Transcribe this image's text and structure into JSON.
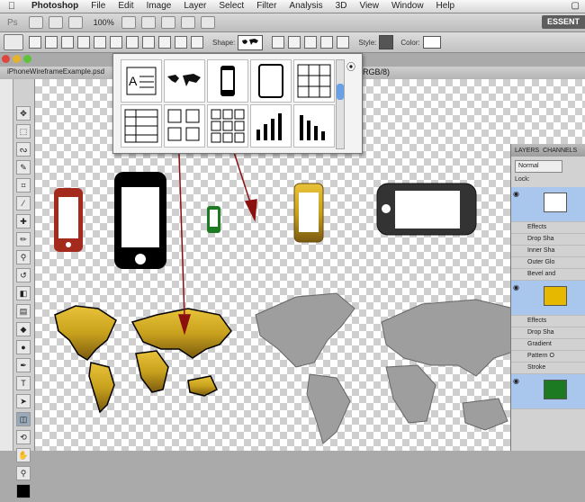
{
  "menubar": {
    "items": [
      "Photoshop",
      "File",
      "Edit",
      "Image",
      "Layer",
      "Select",
      "Filter",
      "Analysis",
      "3D",
      "View",
      "Window",
      "Help"
    ]
  },
  "appbar": {
    "ps_label": "Ps",
    "zoom": "100%",
    "workspace": "ESSENT"
  },
  "options": {
    "shape_label": "Shape:",
    "style_label": "Style:",
    "color_label": "Color:"
  },
  "document": {
    "tab_title": "iPhoneWireframeExample.psd",
    "mode": "(RGB/8)"
  },
  "layers": {
    "tabs": [
      "LAYERS",
      "CHANNELS"
    ],
    "blend_mode": "Normal",
    "lock_label": "Lock:",
    "rows": [
      {
        "label": "Effects"
      },
      {
        "label": "Drop Sha"
      },
      {
        "label": "Inner Sha"
      },
      {
        "label": "Outer Glo"
      },
      {
        "label": "Bevel and"
      },
      {
        "label": "Effects"
      },
      {
        "label": "Drop Sha"
      },
      {
        "label": "Gradient"
      },
      {
        "label": "Pattern O"
      },
      {
        "label": "Stroke"
      }
    ]
  },
  "colors": {
    "red_phone": "#a32a1c",
    "green_phone": "#1c7a22",
    "gold_map": "#c9a21d"
  }
}
